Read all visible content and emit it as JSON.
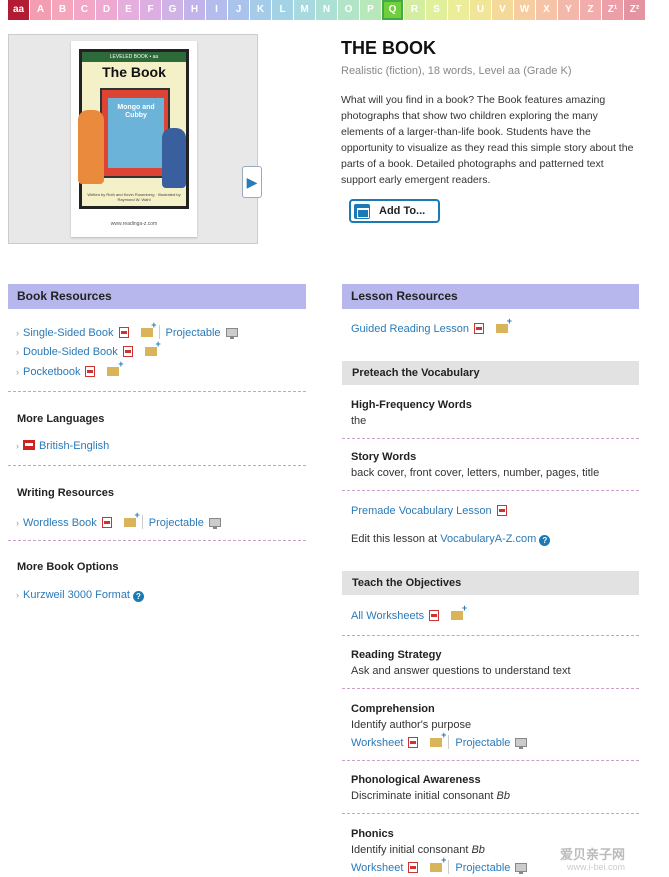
{
  "levels": [
    {
      "label": "aa",
      "color": "#b31b34"
    },
    {
      "label": "A",
      "color": "#f29db0"
    },
    {
      "label": "B",
      "color": "#f4a6bc"
    },
    {
      "label": "C",
      "color": "#f2a7c6"
    },
    {
      "label": "D",
      "color": "#eea9d2"
    },
    {
      "label": "E",
      "color": "#e6aedc"
    },
    {
      "label": "F",
      "color": "#dcaee2"
    },
    {
      "label": "G",
      "color": "#cfb2e6"
    },
    {
      "label": "H",
      "color": "#c2b4ea"
    },
    {
      "label": "I",
      "color": "#b3bcec"
    },
    {
      "label": "J",
      "color": "#a9c3ec"
    },
    {
      "label": "K",
      "color": "#a4cbe8"
    },
    {
      "label": "L",
      "color": "#a2d3e4"
    },
    {
      "label": "M",
      "color": "#a7d9de"
    },
    {
      "label": "N",
      "color": "#ade0d4"
    },
    {
      "label": "O",
      "color": "#b2e4c8"
    },
    {
      "label": "P",
      "color": "#b8e8b9"
    },
    {
      "label": "Q",
      "color": "#6fcf3c"
    },
    {
      "label": "R",
      "color": "#d3eda1"
    },
    {
      "label": "S",
      "color": "#dfef9a"
    },
    {
      "label": "T",
      "color": "#ebed98"
    },
    {
      "label": "U",
      "color": "#f1e597"
    },
    {
      "label": "V",
      "color": "#f4d99b"
    },
    {
      "label": "W",
      "color": "#f5cda0"
    },
    {
      "label": "X",
      "color": "#f5c3a5"
    },
    {
      "label": "Y",
      "color": "#f4b8ab"
    },
    {
      "label": "Z",
      "color": "#f1acac"
    },
    {
      "label": "Z¹",
      "color": "#ed9fa8"
    },
    {
      "label": "Z²",
      "color": "#e493a0"
    }
  ],
  "cover": {
    "band": "LEVELED BOOK • aa",
    "title": "The Book",
    "inner_title": "Mongo and Cubby",
    "credit": "Written by Ruth and Kevin Rosenberg · Illustrated by Raymond W. Wahl",
    "url": "www.readinga-z.com"
  },
  "book": {
    "title": "THE BOOK",
    "meta": "Realistic (fiction), 18 words, Level aa (Grade K)",
    "description": "What will you find in a book? The Book features amazing photographs that show two children exploring the many elements of a larger-than-life book. Students have the opportunity to visualize as they read this simple story about the parts of a book. Detailed photographs and patterned text support early emergent readers.",
    "add_to": "Add To..."
  },
  "book_resources": {
    "heading": "Book Resources",
    "single_sided": "Single-Sided Book",
    "double_sided": "Double-Sided Book",
    "pocketbook": "Pocketbook",
    "projectable": "Projectable",
    "more_languages": "More Languages",
    "british": "British-English",
    "writing_resources": "Writing Resources",
    "wordless": "Wordless Book",
    "more_options": "More Book Options",
    "kurzweil": "Kurzweil 3000 Format"
  },
  "lesson_resources": {
    "heading": "Lesson Resources",
    "guided": "Guided Reading Lesson",
    "preteach": "Preteach the Vocabulary",
    "hf_words": "High-Frequency Words",
    "hf_value": "the",
    "story_words": "Story Words",
    "story_value": "back cover, front cover, letters, number, pages, title",
    "premade": "Premade Vocabulary Lesson",
    "edit_prefix": "Edit this lesson at ",
    "edit_link": "VocabularyA-Z.com",
    "teach": "Teach the Objectives",
    "all_worksheets": "All Worksheets",
    "reading_strategy": "Reading Strategy",
    "reading_strategy_value": "Ask and answer questions to understand text",
    "comprehension": "Comprehension",
    "comprehension_value": "Identify author's purpose",
    "worksheet": "Worksheet",
    "projectable": "Projectable",
    "phonological": "Phonological Awareness",
    "phonological_value_prefix": "Discriminate initial consonant ",
    "phonological_value_em": "Bb",
    "phonics": "Phonics",
    "phonics_value_prefix": "Identify initial consonant ",
    "phonics_value_em": "Bb"
  },
  "watermark": {
    "line1": "爱贝亲子网",
    "line2": "www.i-bei.com"
  }
}
